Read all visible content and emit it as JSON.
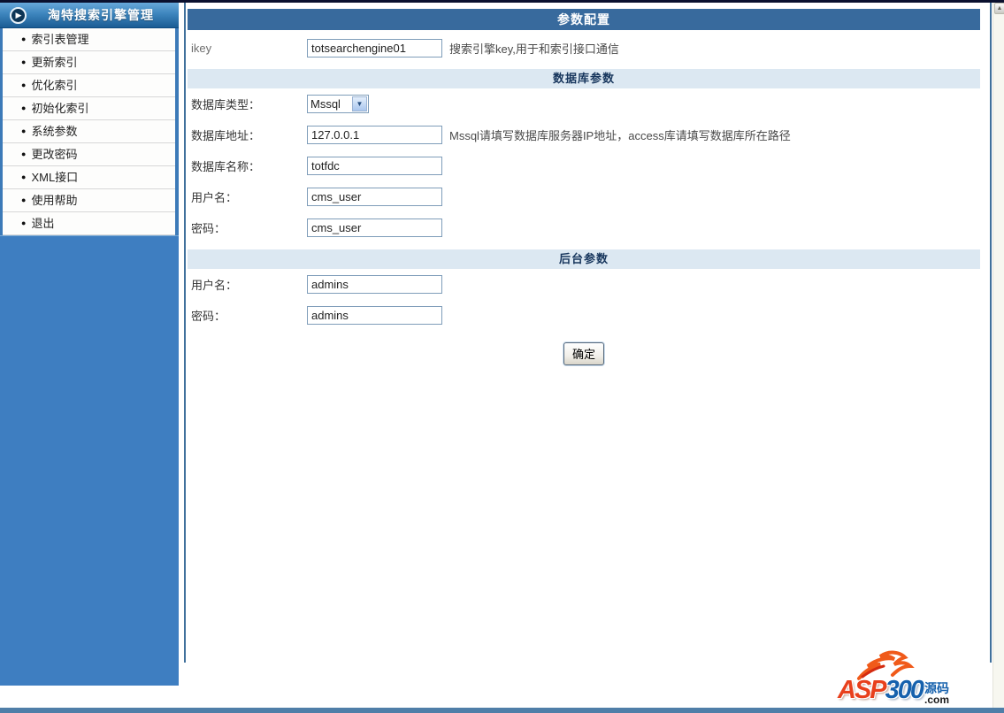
{
  "sidebar": {
    "title": "淘特搜索引擎管理",
    "bullet": "●",
    "items": [
      {
        "label": "索引表管理"
      },
      {
        "label": "更新索引"
      },
      {
        "label": "优化索引"
      },
      {
        "label": "初始化索引"
      },
      {
        "label": "系统参数"
      },
      {
        "label": "更改密码"
      },
      {
        "label": "XML接口"
      },
      {
        "label": "使用帮助"
      },
      {
        "label": "退出"
      }
    ]
  },
  "main": {
    "title": "参数配置",
    "ikey_row": {
      "label": "ikey",
      "value": "totsearchengine01",
      "hint": "搜索引擎key,用于和索引接口通信"
    },
    "db_section_title": "数据库参数",
    "db_type_row": {
      "label": "数据库类型：",
      "selected": "Mssql"
    },
    "db_addr_row": {
      "label": "数据库地址：",
      "value": "127.0.0.1",
      "hint": "Mssql请填写数据库服务器IP地址，access库请填写数据库所在路径"
    },
    "db_name_row": {
      "label": "数据库名称：",
      "value": "totfdc"
    },
    "db_user_row": {
      "label": "用户名：",
      "value": "cms_user"
    },
    "db_pwd_row": {
      "label": "密码：",
      "value": "cms_user"
    },
    "admin_section_title": "后台参数",
    "admin_user_row": {
      "label": "用户名：",
      "value": "admins"
    },
    "admin_pwd_row": {
      "label": "密码：",
      "value": "admins"
    },
    "submit_label": "确定"
  },
  "icons": {
    "play": "▶",
    "dropdown_arrow": "▼",
    "scroll_up": "▲"
  },
  "watermark": {
    "asp": "ASP",
    "num": "300",
    "suffix_cn": "源码",
    "suffix_com": ".com"
  },
  "colors": {
    "panel_title_blue": "#386a9d",
    "section_bar_blue": "#dce8f2",
    "sidebar_fill_blue": "#3e7ec1",
    "bottom_bar_blue": "#4f7ea8",
    "input_border": "#7f9db9"
  }
}
